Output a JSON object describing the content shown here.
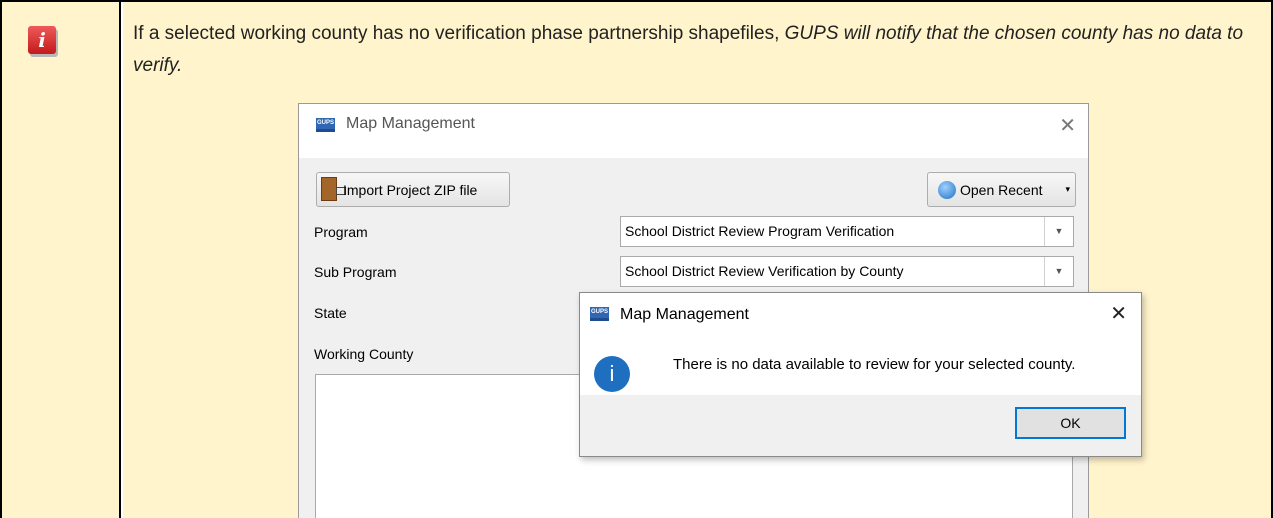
{
  "note": {
    "text_plain": "If a selected working county has no verification phase partnership shapefiles, ",
    "text_italic": "GUPS will notify that the chosen county has no data to verify."
  },
  "icons": {
    "note_icon": "info-icon",
    "msg_icon": "info-circle-icon",
    "close": "close-icon"
  },
  "dialog": {
    "app_badge": "GUPS",
    "title": "Map Management",
    "close_glyph": "✕",
    "import_button": "Import Project ZIP file",
    "recent_button": "Open Recent",
    "recent_caret": "▾",
    "combo_arrow": "▼",
    "fields": [
      {
        "label": "Program",
        "value": "School District Review Program Verification"
      },
      {
        "label": "Sub Program",
        "value": "School District Review Verification by County"
      },
      {
        "label": "State",
        "value": ""
      },
      {
        "label": "Working County",
        "value": ""
      }
    ]
  },
  "message_box": {
    "app_badge": "GUPS",
    "title": "Map Management",
    "close_glyph": "✕",
    "icon_glyph": "i",
    "text": "There is no data available to review for your selected county.",
    "ok_label": "OK"
  },
  "colors": {
    "note_background": "#fff4cc",
    "note_icon": "#d32626",
    "focus_border": "#0078d7",
    "gups_badge": "#2f67b4"
  }
}
